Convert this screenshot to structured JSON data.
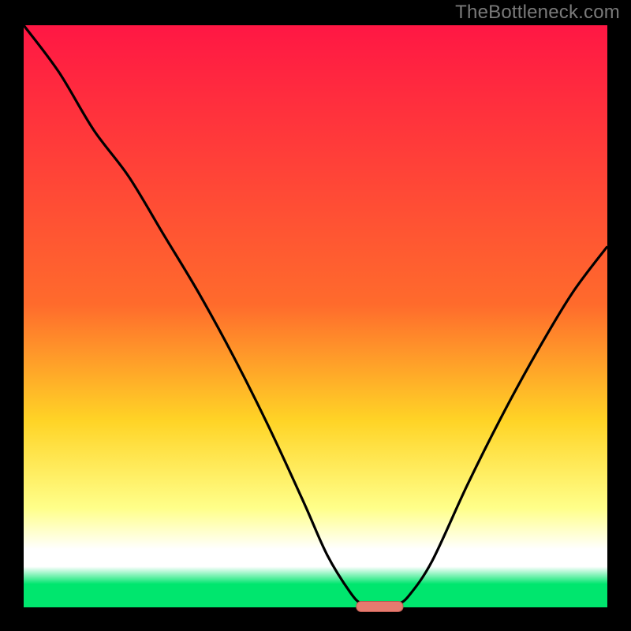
{
  "watermark": "TheBottleneck.com",
  "colors": {
    "bg_black": "#000000",
    "curve": "#000000",
    "watermark": "#7a7a7a",
    "gradient_top": "#ff1744",
    "gradient_mid_up": "#ff6b2c",
    "gradient_mid": "#ffd426",
    "gradient_light": "#ffff8a",
    "gradient_white": "#ffffff",
    "gradient_green": "#00e66e",
    "pill_fill": "#e77a6f",
    "pill_stroke": "#b85a50"
  },
  "chart_data": {
    "type": "line",
    "title": "",
    "xlabel": "",
    "ylabel": "",
    "xlim": [
      0,
      100
    ],
    "ylim": [
      0,
      100
    ],
    "series": [
      {
        "name": "bottleneck-curve",
        "x": [
          0,
          6,
          12,
          18,
          24,
          30,
          36,
          42,
          48,
          52,
          56,
          58,
          60,
          62,
          64,
          66,
          70,
          76,
          82,
          88,
          94,
          100
        ],
        "values": [
          100,
          92,
          82,
          74,
          64,
          54,
          43,
          31,
          18,
          9,
          2.5,
          0.5,
          0,
          0,
          0.5,
          2,
          8,
          21,
          33,
          44,
          54,
          62
        ]
      }
    ],
    "marker": {
      "name": "optimal-range-pill",
      "x_start": 57,
      "x_end": 65,
      "y": 0
    },
    "gradient_stops_pct": [
      0,
      48,
      68,
      83,
      90,
      93,
      96,
      100
    ]
  }
}
